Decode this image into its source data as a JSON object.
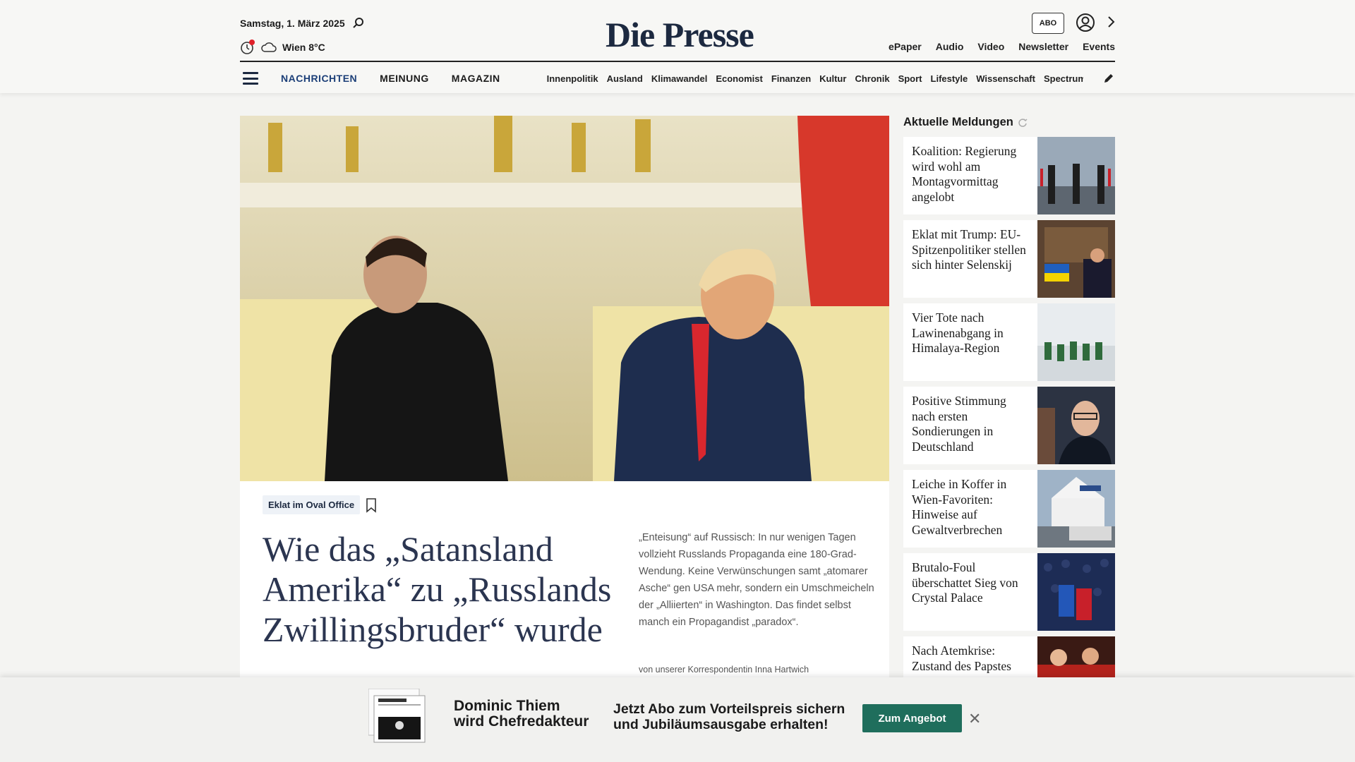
{
  "header": {
    "date": "Samstag, 1. März 2025",
    "weather": "Wien 8°C",
    "logo": "Die Presse",
    "abo_label": "ABO",
    "top_links": [
      "ePaper",
      "Audio",
      "Video",
      "Newsletter",
      "Events"
    ]
  },
  "nav": {
    "main": [
      "NACHRICHTEN",
      "MEINUNG",
      "MAGAZIN"
    ],
    "sub": [
      "Innenpolitik",
      "Ausland",
      "Klimawandel",
      "Economist",
      "Finanzen",
      "Kultur",
      "Chronik",
      "Sport",
      "Lifestyle",
      "Wissenschaft",
      "Spectrum"
    ]
  },
  "hero": {
    "kicker": "Eklat im Oval Office",
    "headline": "Wie das „Satansland Amerika“ zu „Russlands Zwillingsbruder“ wurde",
    "teaser": "„Enteisung“ auf Russisch: In nur wenigen Tagen vollzieht Russlands Propaganda eine 180-Grad-Wendung. Keine Verwünschungen samt „atomarer Asche“ gen USA mehr, sondern ein Umschmeicheln der „Alliierten“ in Washington. Das findet selbst manch ein Propagandist „paradox“.",
    "byline": "von unserer Korrespondentin Inna Hartwich"
  },
  "sidebar": {
    "title": "Aktuelle Meldungen",
    "items": [
      {
        "title": "Koalition: Regierung wird wohl am Montagvormittag angelobt"
      },
      {
        "title": "Eklat mit Trump: EU-Spitzenpolitiker stellen sich hinter Selenskij"
      },
      {
        "title": "Vier Tote nach Lawinenabgang in Himalaya-Region"
      },
      {
        "title": "Positive Stimmung nach ersten Sondierungen in Deutschland"
      },
      {
        "title": "Leiche in Koffer in Wien-Favoriten: Hinweise auf Gewaltverbrechen"
      },
      {
        "title": "Brutalo-Foul überschattet Sieg von Crystal Palace"
      },
      {
        "title": "Nach Atemkrise: Zustand des Papstes"
      }
    ]
  },
  "promo": {
    "name_line1": "Dominic Thiem",
    "name_line2": "wird Chefredakteur",
    "offer_line1": "Jetzt Abo zum Vorteilspreis sichern",
    "offer_line2": "und Jubiläumsausgabe erhalten!",
    "button": "Zum Angebot"
  }
}
